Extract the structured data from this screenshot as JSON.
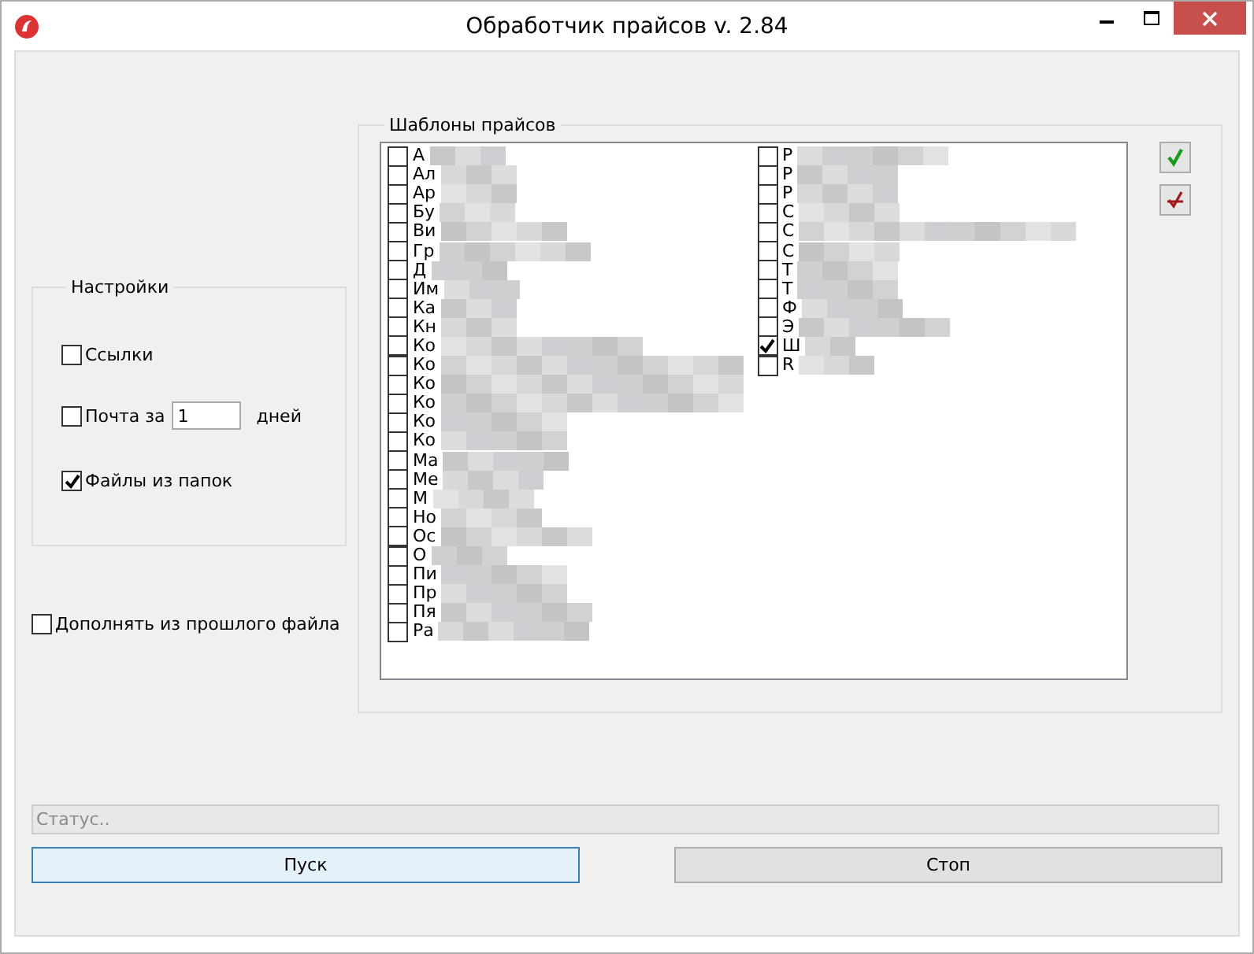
{
  "window": {
    "title": "Обработчик прайсов v. 2.84"
  },
  "settings": {
    "title": "Настройки",
    "links": {
      "label": "Ссылки",
      "checked": false
    },
    "mail": {
      "label": "Почта за",
      "checked": false,
      "value": "1",
      "unit": "дней"
    },
    "folders": {
      "label": "Файлы из папок",
      "checked": true
    }
  },
  "append_previous": {
    "label": "Дополнять из прошлого файла",
    "checked": false
  },
  "templates": {
    "title": "Шаблоны прайсов",
    "columns": [
      [
        {
          "label": "А",
          "checked": false
        },
        {
          "label": "Ал",
          "checked": false
        },
        {
          "label": "Ар",
          "checked": false
        },
        {
          "label": "Бу",
          "checked": false
        },
        {
          "label": "Ви",
          "checked": false
        },
        {
          "label": "Гр",
          "checked": false
        },
        {
          "label": "Д",
          "checked": false
        },
        {
          "label": "Им",
          "checked": false
        },
        {
          "label": "Ка",
          "checked": false
        },
        {
          "label": "Кн",
          "checked": false
        },
        {
          "label": "Ко",
          "checked": false
        },
        {
          "label": "Ко",
          "checked": false
        },
        {
          "label": "Ко",
          "checked": false
        },
        {
          "label": "Ко",
          "checked": false
        },
        {
          "label": "Ко",
          "checked": false
        },
        {
          "label": "Ко",
          "checked": false
        },
        {
          "label": "Ма",
          "checked": false
        },
        {
          "label": "Ме",
          "checked": false
        },
        {
          "label": "М",
          "checked": false
        },
        {
          "label": "Но",
          "checked": false
        },
        {
          "label": "Ос",
          "checked": false
        },
        {
          "label": "О",
          "checked": false
        },
        {
          "label": "Пи",
          "checked": false
        },
        {
          "label": "Пр",
          "checked": false
        },
        {
          "label": "Пя",
          "checked": false
        },
        {
          "label": "Ра",
          "checked": false
        }
      ],
      [
        {
          "label": "Р",
          "checked": false
        },
        {
          "label": "Р",
          "checked": false
        },
        {
          "label": "Р",
          "checked": false
        },
        {
          "label": "С",
          "checked": false
        },
        {
          "label": "С",
          "checked": false
        },
        {
          "label": "С",
          "checked": false
        },
        {
          "label": "Т",
          "checked": false
        },
        {
          "label": "Т",
          "checked": false
        },
        {
          "label": "Ф",
          "checked": false
        },
        {
          "label": "Э",
          "checked": false
        },
        {
          "label": "Ш",
          "checked": true
        },
        {
          "label": "R",
          "checked": false
        }
      ]
    ]
  },
  "status": {
    "placeholder": "Статус.."
  },
  "buttons": [
    {
      "label": "Пуск",
      "focused": true
    },
    {
      "label": "Стоп",
      "focused": false
    }
  ]
}
